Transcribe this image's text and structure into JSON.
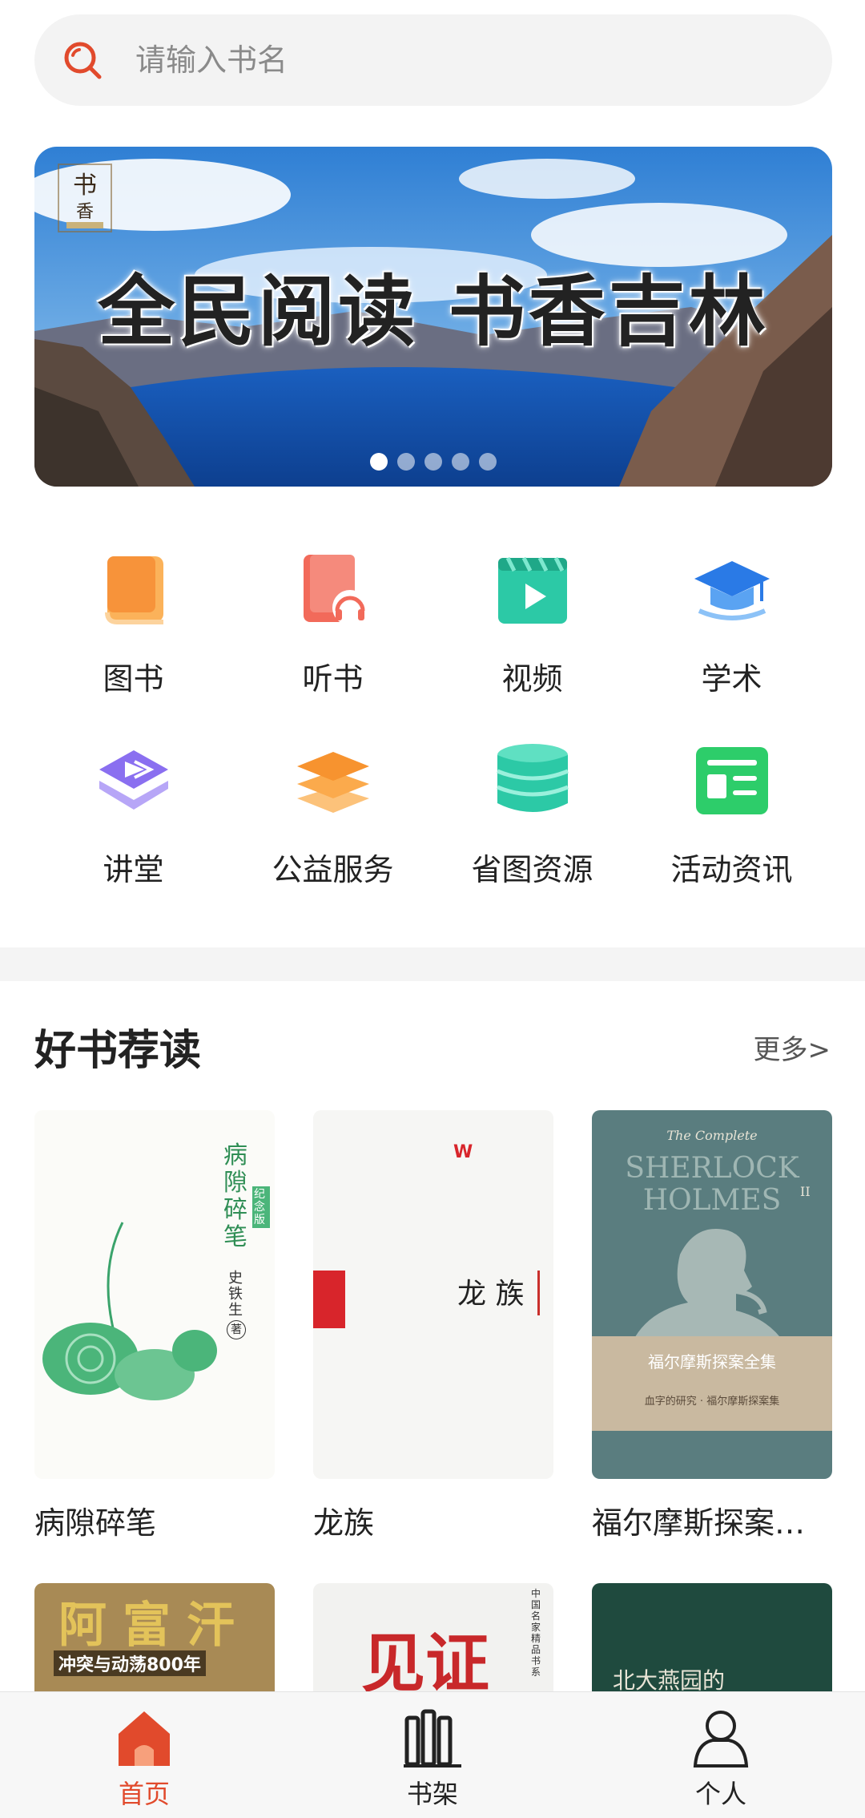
{
  "search": {
    "placeholder": "请输入书名"
  },
  "banner": {
    "slogan": "全民阅读 书香吉林",
    "logo_text": "书香",
    "slide_count": 5,
    "active_slide": 1
  },
  "categories": [
    {
      "label": "图书",
      "icon": "book-icon",
      "color": "#f7a24a"
    },
    {
      "label": "听书",
      "icon": "audiobook-icon",
      "color": "#f26a5a"
    },
    {
      "label": "视频",
      "icon": "video-icon",
      "color": "#2cc9a6"
    },
    {
      "label": "学术",
      "icon": "graduation-cap-icon",
      "color": "#3a8de8"
    },
    {
      "label": "讲堂",
      "icon": "lecture-icon",
      "color": "#8a6ff0"
    },
    {
      "label": "公益服务",
      "icon": "layers-icon",
      "color": "#f7a24a"
    },
    {
      "label": "省图资源",
      "icon": "database-icon",
      "color": "#2cc9a6"
    },
    {
      "label": "活动资讯",
      "icon": "news-icon",
      "color": "#2dcd6a"
    }
  ],
  "recommend": {
    "title": "好书荐读",
    "more": "更多>",
    "books": [
      {
        "title": "病隙碎笔",
        "cover": {
          "title": "病隙碎笔",
          "badge": "纪念版",
          "author": "史铁生",
          "mark": "著"
        }
      },
      {
        "title": "龙族",
        "cover": {
          "title": "龙 族"
        }
      },
      {
        "title": "福尔摩斯探案全集",
        "cover": {
          "top": "The Complete",
          "main1": "SHERLOCK",
          "main2": "HOLMES",
          "volume": "II",
          "cn_title": "福尔摩斯探案全集",
          "sub": "血字的研究 · 福尔摩斯探案集"
        }
      }
    ],
    "books_row2": [
      {
        "cover": {
          "title": "阿富汗",
          "sub": "冲突与动荡800年"
        }
      },
      {
        "cover": {
          "title": "见证",
          "side": "中国名家精品书系"
        }
      },
      {
        "cover": {
          "title": "北大燕园的"
        }
      }
    ]
  },
  "tabbar": {
    "items": [
      {
        "label": "首页",
        "icon": "home-icon",
        "active": true
      },
      {
        "label": "书架",
        "icon": "bookshelf-icon",
        "active": false
      },
      {
        "label": "个人",
        "icon": "person-icon",
        "active": false
      }
    ],
    "active_color": "#e14a2c"
  }
}
